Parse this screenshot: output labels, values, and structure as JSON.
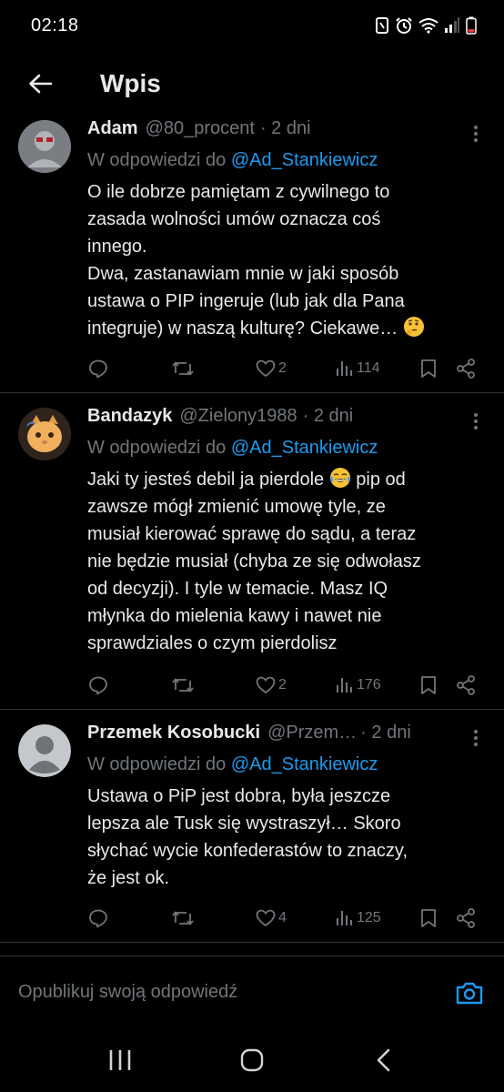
{
  "status_bar": {
    "time": "02:18"
  },
  "header": {
    "title": "Wpis"
  },
  "replies": [
    {
      "author": "Adam",
      "handle": "@80_procent",
      "time": "· 2 dni",
      "replying_prefix": "W odpowiedzi do",
      "replying_to": "@Ad_Stankiewicz",
      "lines": [
        "O ile dobrze pamiętam z cywilnego to",
        "zasada wolności umów oznacza coś",
        "innego.",
        "Dwa, zastanawiam mnie w jaki sposób",
        "ustawa o PIP ingeruje (lub jak dla Pana",
        "integruje) w naszą kulturę? Ciekawe…"
      ],
      "emoji": "thinking-face",
      "likes": "2",
      "views": "114"
    },
    {
      "author": "Bandazyk",
      "handle": "@Zielony1988",
      "time": "· 2 dni",
      "replying_prefix": "W odpowiedzi do",
      "replying_to": "@Ad_Stankiewicz",
      "lines": [
        "Jaki ty jesteś debil ja pierdole",
        "zawsze mógł zmienić umowę tyle, ze",
        "musiał kierować sprawę do sądu, a teraz",
        "nie będzie musiał (chyba ze się odwołasz",
        "od decyzji). I tyle w temacie. Masz IQ",
        "młynka do mielenia kawy i nawet nie",
        "sprawdziales o czym pierdolisz"
      ],
      "line1_after_emoji": "pip od",
      "emoji": "tears-of-joy",
      "likes": "2",
      "views": "176"
    },
    {
      "author": "Przemek Kosobucki",
      "handle": "@Przem…",
      "time": "· 2 dni",
      "replying_prefix": "W odpowiedzi do",
      "replying_to": "@Ad_Stankiewicz",
      "lines": [
        "Ustawa o PiP jest dobra, była jeszcze",
        "lepsza ale Tusk się wystraszył… Skoro",
        "słychać wycie konfederastów to znaczy,",
        "że jest ok."
      ],
      "likes": "4",
      "views": "125"
    }
  ],
  "compose": {
    "placeholder": "Opublikuj swoją odpowiedź"
  },
  "colors": {
    "accent": "#1d9bf0",
    "muted": "#71767b",
    "text": "#e7e9ea",
    "divider": "#2f3336"
  },
  "icons": [
    "back-arrow-icon",
    "more-icon",
    "reply-icon",
    "retweet-icon",
    "like-icon",
    "views-icon",
    "bookmark-icon",
    "share-icon",
    "camera-icon"
  ]
}
